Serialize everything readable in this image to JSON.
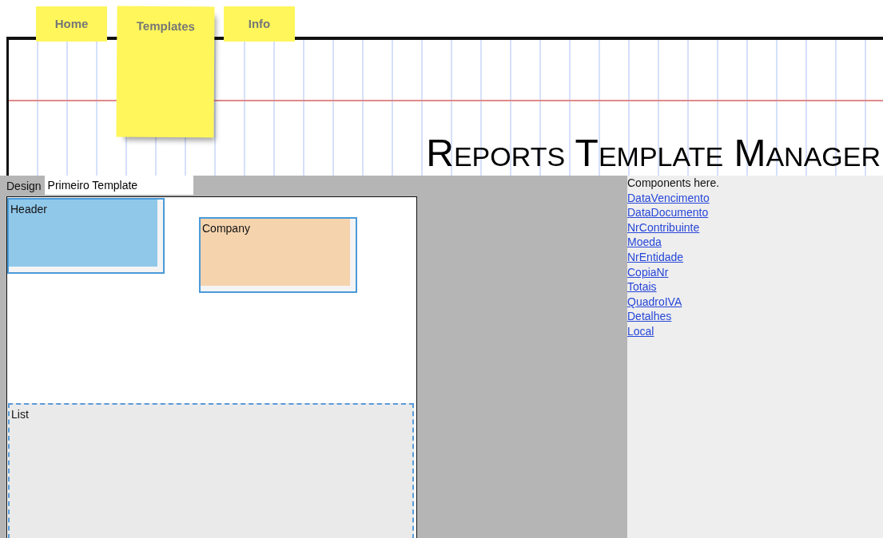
{
  "tabs": [
    {
      "label": "Home",
      "selected": false
    },
    {
      "label": "Templates",
      "selected": true
    },
    {
      "label": "Info",
      "selected": false
    }
  ],
  "title": "Reports Template Manager",
  "design": {
    "label": "Design",
    "value": "Primeiro Template"
  },
  "canvas": {
    "blocks": [
      {
        "kind": "block",
        "label": "Header",
        "color": "#90c8ea"
      },
      {
        "kind": "block",
        "label": "Company",
        "color": "#f5d3ad"
      },
      {
        "kind": "list",
        "label": "List",
        "color": "#eaeaea"
      }
    ]
  },
  "components": {
    "heading": "Components here.",
    "items": [
      "DataVencimento",
      "DataDocumento",
      "NrContribuinte",
      "Moeda",
      "NrEntidade",
      "CopiaNr",
      "Totais",
      "QuadroIVA",
      "Detalhes",
      "Local"
    ]
  }
}
